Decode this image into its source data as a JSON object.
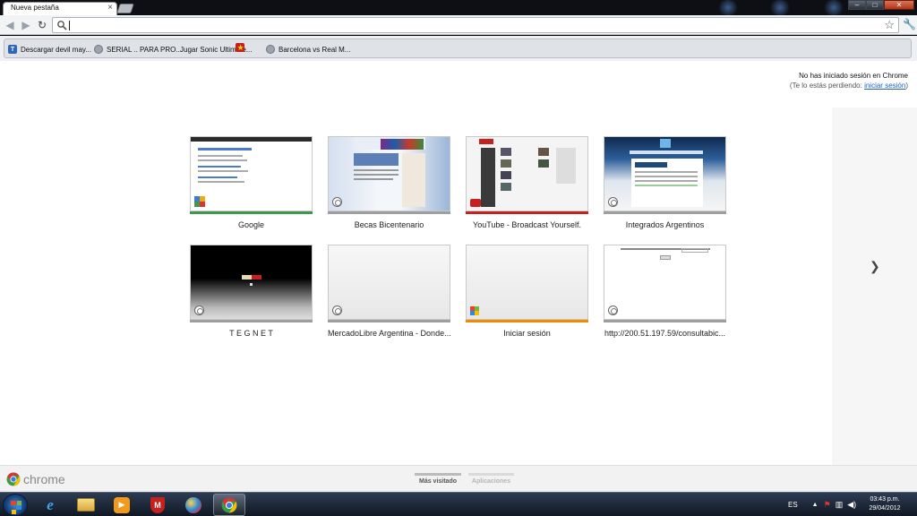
{
  "browser": {
    "tab_title": "Nueva pestaña",
    "address_value": "",
    "toolbar_icons": [
      "back-icon",
      "forward-icon",
      "reload-icon",
      "search-icon",
      "star-icon",
      "wrench-icon"
    ]
  },
  "bookmarks": [
    {
      "label": "Descargar devil may...",
      "icon": "t-favicon"
    },
    {
      "label": "SERIAL .. PARA PRO...",
      "icon": "globe-favicon"
    },
    {
      "label": "Jugar Sonic Ultimate...",
      "icon": "star-favicon"
    },
    {
      "label": "Barcelona vs Real M...",
      "icon": "globe-favicon"
    }
  ],
  "signin": {
    "line1": "No has iniciado sesión en Chrome",
    "line2_prefix": "(Te lo estás perdiendo: ",
    "link": "iniciar sesión",
    "line2_suffix": ")"
  },
  "most_visited": [
    {
      "title": "Google",
      "accent": "#3d9a4a"
    },
    {
      "title": "Becas Bicentenario",
      "accent": "#9e9e9e"
    },
    {
      "title": "YouTube - Broadcast Yourself.",
      "accent": "#c8201f"
    },
    {
      "title": "Integrados Argentinos",
      "accent": "#9e9e9e"
    },
    {
      "title": "T E G N E T",
      "accent": "#9e9e9e"
    },
    {
      "title": "MercadoLibre Argentina - Donde...",
      "accent": "#9e9e9e"
    },
    {
      "title": "Iniciar sesión",
      "accent": "#f08a00"
    },
    {
      "title": "http://200.51.197.59/consultabic...",
      "accent": "#9e9e9e"
    }
  ],
  "bottom": {
    "brand": "chrome",
    "tabs": [
      "Más visitado",
      "Aplicaciones"
    ]
  },
  "taskbar": {
    "apps": [
      "internet-explorer-icon",
      "file-explorer-icon",
      "media-player-icon",
      "mcafee-icon",
      "paint-icon",
      "chrome-icon"
    ],
    "language": "ES",
    "time": "03:43 p.m.",
    "date": "29/04/2012"
  }
}
